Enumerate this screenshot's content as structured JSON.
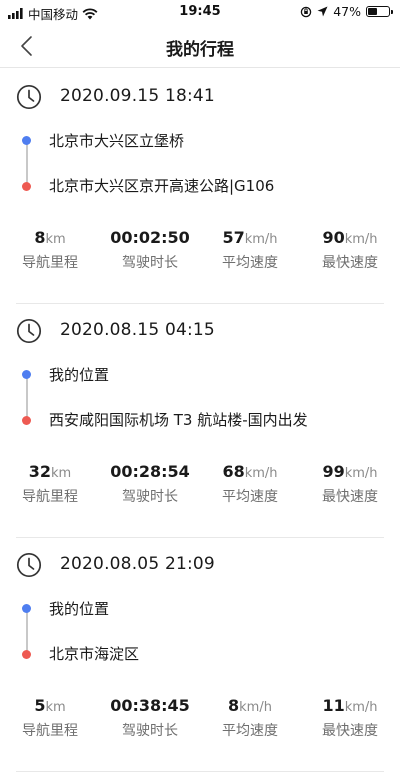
{
  "status_bar": {
    "carrier": "中国移动",
    "time": "19:45",
    "battery_text": "47%",
    "battery_level": 0.47
  },
  "nav": {
    "title": "我的行程"
  },
  "trips": [
    {
      "datetime": "2020.09.15 18:41",
      "start": "北京市大兴区立堡桥",
      "end": "北京市大兴区京开高速公路|G106",
      "distance": {
        "value": "8",
        "unit": "km",
        "label": "导航里程"
      },
      "duration": {
        "value": "00:02:50",
        "label": "驾驶时长"
      },
      "avg_speed": {
        "value": "57",
        "unit": "km/h",
        "label": "平均速度"
      },
      "max_speed": {
        "value": "90",
        "unit": "km/h",
        "label": "最快速度"
      }
    },
    {
      "datetime": "2020.08.15 04:15",
      "start": "我的位置",
      "end": "西安咸阳国际机场 T3 航站楼-国内出发",
      "distance": {
        "value": "32",
        "unit": "km",
        "label": "导航里程"
      },
      "duration": {
        "value": "00:28:54",
        "label": "驾驶时长"
      },
      "avg_speed": {
        "value": "68",
        "unit": "km/h",
        "label": "平均速度"
      },
      "max_speed": {
        "value": "99",
        "unit": "km/h",
        "label": "最快速度"
      }
    },
    {
      "datetime": "2020.08.05 21:09",
      "start": "我的位置",
      "end": "北京市海淀区",
      "distance": {
        "value": "5",
        "unit": "km",
        "label": "导航里程"
      },
      "duration": {
        "value": "00:38:45",
        "label": "驾驶时长"
      },
      "avg_speed": {
        "value": "8",
        "unit": "km/h",
        "label": "平均速度"
      },
      "max_speed": {
        "value": "11",
        "unit": "km/h",
        "label": "最快速度"
      }
    }
  ]
}
